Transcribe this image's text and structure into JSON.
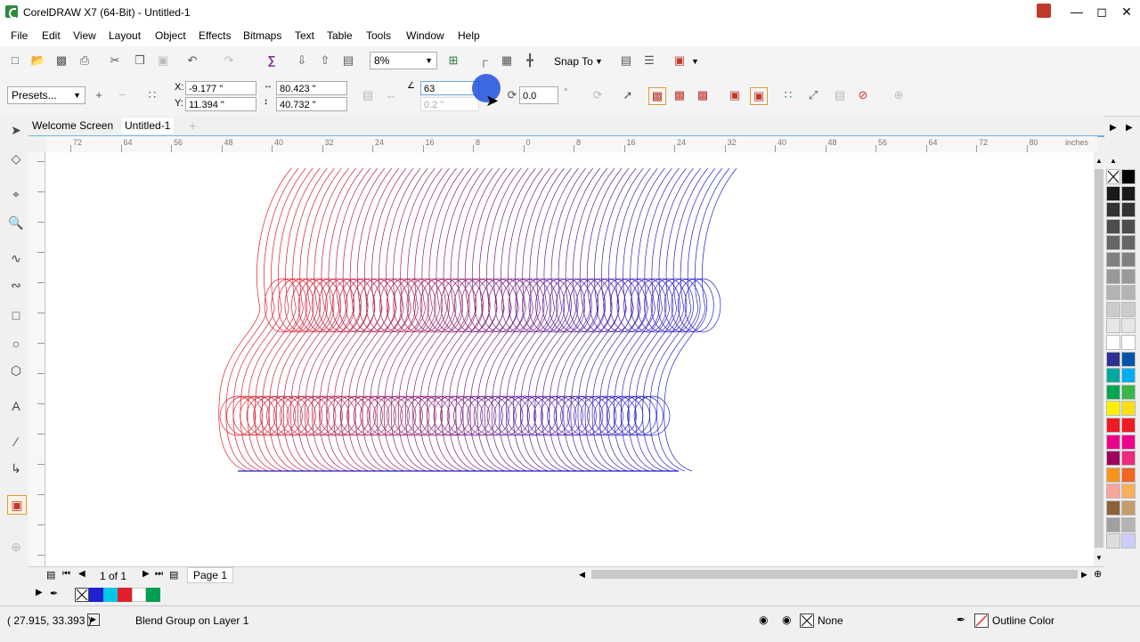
{
  "app": {
    "title": "CorelDRAW X7 (64-Bit) - Untitled-1"
  },
  "menu": [
    "File",
    "Edit",
    "View",
    "Layout",
    "Object",
    "Effects",
    "Bitmaps",
    "Text",
    "Table",
    "Tools",
    "Window",
    "Help"
  ],
  "toolbar": {
    "zoom_value": "8%",
    "snap_to_label": "Snap To"
  },
  "property_bar": {
    "presets_label": "Presets...",
    "x_value": "-9.177 \"",
    "y_value": "11.394 \"",
    "width_value": "80.423 \"",
    "height_value": "40.732 \"",
    "x_label": "X:",
    "y_label": "Y:",
    "blend_steps_value": "63",
    "blend_spacing_value": "0.2 \"",
    "blend_direction_value": "0.0",
    "degree_symbol": "°"
  },
  "tabs": [
    "Welcome Screen",
    "Untitled-1"
  ],
  "ruler": {
    "h_ticks": [
      "72",
      "64",
      "56",
      "48",
      "40",
      "32",
      "24",
      "16",
      "8",
      "0",
      "8",
      "16",
      "24",
      "32",
      "40",
      "48",
      "56",
      "64",
      "72",
      "80"
    ],
    "h_unit": "inches"
  },
  "page_nav": {
    "page_count": "1 of 1",
    "page_tab": "Page 1"
  },
  "status": {
    "coordinates": "( 27.915, 33.393 )",
    "selection_info": "Blend Group on Layer 1",
    "fill_label": "None",
    "outline_label": "Outline Color"
  },
  "colors": {
    "blend_start": "#e0202a",
    "blend_end": "#2020d0",
    "tab_accent": "#6fb3e6"
  },
  "icons": [
    "new-icon",
    "open-icon",
    "save-icon",
    "print-icon",
    "cut-icon",
    "copy-icon",
    "paste-icon",
    "undo-icon",
    "redo-icon",
    "import-icon",
    "export-icon",
    "publish-pdf-icon",
    "zoom-icon",
    "welcome-icon",
    "options-icon"
  ]
}
